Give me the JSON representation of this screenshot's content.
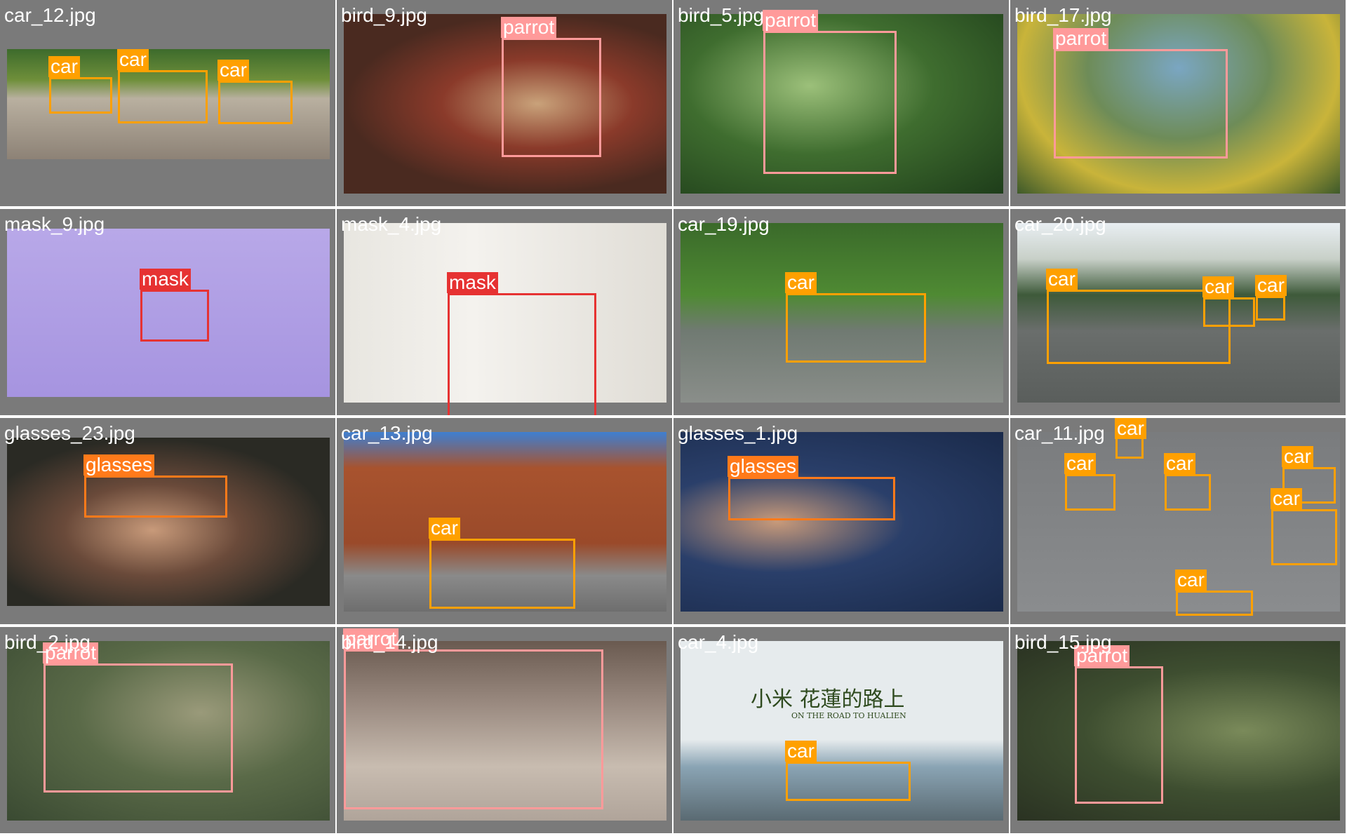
{
  "colors": {
    "car": "#ffa000",
    "parrot": "#ff9a9a",
    "mask": "#e63232",
    "glasses": "#ff7a1a",
    "cell_bg": "#7a7a7a"
  },
  "cells": [
    {
      "filename": "car_12.jpg",
      "detections": [
        {
          "label": "car"
        },
        {
          "label": "car"
        },
        {
          "label": "car"
        }
      ]
    },
    {
      "filename": "bird_9.jpg",
      "detections": [
        {
          "label": "parrot"
        }
      ]
    },
    {
      "filename": "bird_5.jpg",
      "detections": [
        {
          "label": "parrot"
        }
      ]
    },
    {
      "filename": "bird_17.jpg",
      "detections": [
        {
          "label": "parrot"
        }
      ]
    },
    {
      "filename": "mask_9.jpg",
      "detections": [
        {
          "label": "mask"
        }
      ]
    },
    {
      "filename": "mask_4.jpg",
      "detections": [
        {
          "label": "mask"
        }
      ]
    },
    {
      "filename": "car_19.jpg",
      "detections": [
        {
          "label": "car"
        }
      ]
    },
    {
      "filename": "car_20.jpg",
      "detections": [
        {
          "label": "car"
        },
        {
          "label": "car"
        },
        {
          "label": "car"
        }
      ]
    },
    {
      "filename": "glasses_23.jpg",
      "detections": [
        {
          "label": "glasses"
        }
      ]
    },
    {
      "filename": "car_13.jpg",
      "detections": [
        {
          "label": "car"
        }
      ]
    },
    {
      "filename": "glasses_1.jpg",
      "detections": [
        {
          "label": "glasses"
        }
      ]
    },
    {
      "filename": "car_11.jpg",
      "detections": [
        {
          "label": "car"
        },
        {
          "label": "car"
        },
        {
          "label": "car"
        },
        {
          "label": "car"
        },
        {
          "label": "car"
        },
        {
          "label": "car"
        }
      ]
    },
    {
      "filename": "bird_2.jpg",
      "detections": [
        {
          "label": "parrot"
        }
      ]
    },
    {
      "filename": "bird_14.jpg",
      "detections": [
        {
          "label": "parrot"
        }
      ]
    },
    {
      "filename": "car_4.jpg",
      "detections": [
        {
          "label": "car"
        }
      ],
      "overlay_title": "小米 花蓮的路上",
      "overlay_subtitle": "ON THE ROAD TO HUALIEN"
    },
    {
      "filename": "bird_15.jpg",
      "detections": [
        {
          "label": "parrot"
        }
      ]
    }
  ]
}
